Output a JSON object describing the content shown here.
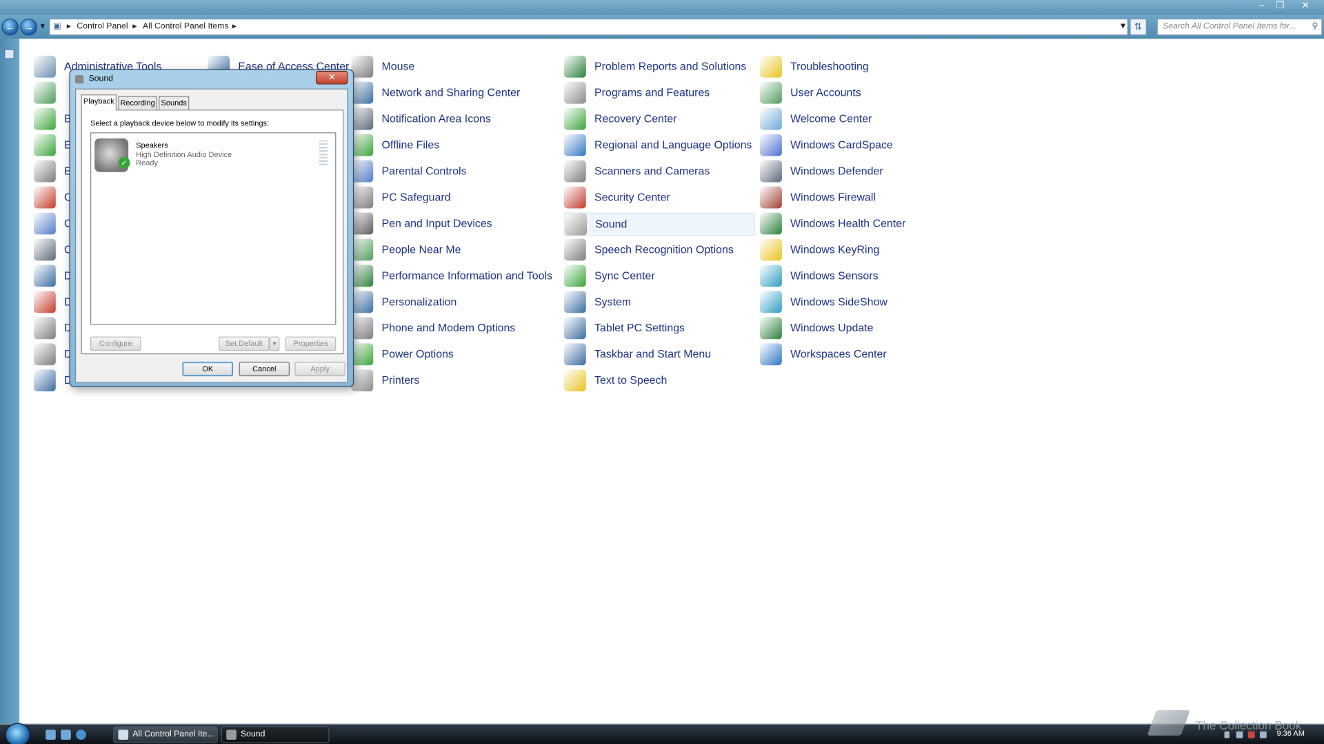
{
  "breadcrumb": [
    "Control Panel",
    "All Control Panel Items"
  ],
  "search_placeholder": "Search All Control Panel Items for...",
  "items": [
    {
      "label": "Administrative Tools",
      "color": "#6a8fb0"
    },
    {
      "label": "Ease of Access Center",
      "color": "#3a6da0"
    },
    {
      "label": "Mouse",
      "color": "#7d7d7d"
    },
    {
      "label": "Problem Reports and Solutions",
      "color": "#2a7f3a"
    },
    {
      "label": "Troubleshooting",
      "color": "#e8c21e"
    },
    {
      "label": "Network and Sharing Center",
      "color": "#3a6da0"
    },
    {
      "label": "Programs and Features",
      "color": "#8a8a8a"
    },
    {
      "label": "User Accounts",
      "color": "#4f9c5a"
    },
    {
      "label": "Notification Area Icons",
      "color": "#5a6878"
    },
    {
      "label": "Recovery Center",
      "color": "#3aa43a"
    },
    {
      "label": "Welcome Center",
      "color": "#6fa8d8"
    },
    {
      "label": "Offline Files",
      "color": "#3aa43a"
    },
    {
      "label": "Regional and Language Options",
      "color": "#2f76c4"
    },
    {
      "label": "Windows CardSpace",
      "color": "#4a6fd0"
    },
    {
      "label": "Parental Controls",
      "color": "#4f7bc8"
    },
    {
      "label": "Scanners and Cameras",
      "color": "#7d7d7d"
    },
    {
      "label": "Windows Defender",
      "color": "#5a6878"
    },
    {
      "label": "PC Safeguard",
      "color": "#7d7d7d"
    },
    {
      "label": "Security Center",
      "color": "#c43b2b"
    },
    {
      "label": "Windows Firewall",
      "color": "#a0402f"
    },
    {
      "label": "Pen and Input Devices",
      "color": "#5a5a5a"
    },
    {
      "label": "Sound",
      "color": "#9a9a9a"
    },
    {
      "label": "Windows Health Center",
      "color": "#2a7f3a"
    },
    {
      "label": "People Near Me",
      "color": "#4f9c5a"
    },
    {
      "label": "Speech Recognition Options",
      "color": "#7d7d7d"
    },
    {
      "label": "Windows KeyRing",
      "color": "#e8c21e"
    },
    {
      "label": "Performance Information and Tools",
      "color": "#2a7f3a"
    },
    {
      "label": "Sync Center",
      "color": "#3aa43a"
    },
    {
      "label": "Windows Sensors",
      "color": "#2f9cc4"
    },
    {
      "label": "Personalization",
      "color": "#3a6da0"
    },
    {
      "label": "System",
      "color": "#3a6da0"
    },
    {
      "label": "Windows SideShow",
      "color": "#2f9cc4"
    },
    {
      "label": "Phone and Modem Options",
      "color": "#7d7d7d"
    },
    {
      "label": "Tablet PC Settings",
      "color": "#3a6da0"
    },
    {
      "label": "Windows Update",
      "color": "#2a7f3a"
    },
    {
      "label": "Power Options",
      "color": "#3aa43a"
    },
    {
      "label": "Taskbar and Start Menu",
      "color": "#3a6da0"
    },
    {
      "label": "Workspaces Center",
      "color": "#2f76c4"
    },
    {
      "label": "Printers",
      "color": "#8a8a8a"
    },
    {
      "label": "Text to Speech",
      "color": "#e8c21e"
    }
  ],
  "left_column_icons": [
    "#6a8fb0",
    "#4f9c5a",
    "#3aa43a",
    "#3aa43a",
    "#7d7d7d",
    "#c43b2b",
    "#4f7bc8",
    "#5a6878",
    "#3a6da0",
    "#c43b2b",
    "#7d7d7d",
    "#7d7d7d",
    "#3a6da0"
  ],
  "left_column_letters": [
    "A",
    "",
    "B",
    "E",
    "E",
    "C",
    "C",
    "C",
    "D",
    "D",
    "D",
    "D",
    "D"
  ],
  "dialog": {
    "title": "Sound",
    "tabs": [
      "Playback",
      "Recording",
      "Sounds"
    ],
    "instruction": "Select a playback device below to modify its settings:",
    "device": {
      "name": "Speakers",
      "description": "High Definition Audio Device",
      "status": "Ready"
    },
    "buttons": {
      "configure": "Configure",
      "set_default": "Set Default",
      "properties": "Properties",
      "ok": "OK",
      "cancel": "Cancel",
      "apply": "Apply"
    }
  },
  "taskbar": {
    "buttons": [
      "All Control Panel Ite...",
      "Sound"
    ],
    "clock": "9:36 AM"
  },
  "watermark": "The Collection Book",
  "accent": "#1e3287"
}
